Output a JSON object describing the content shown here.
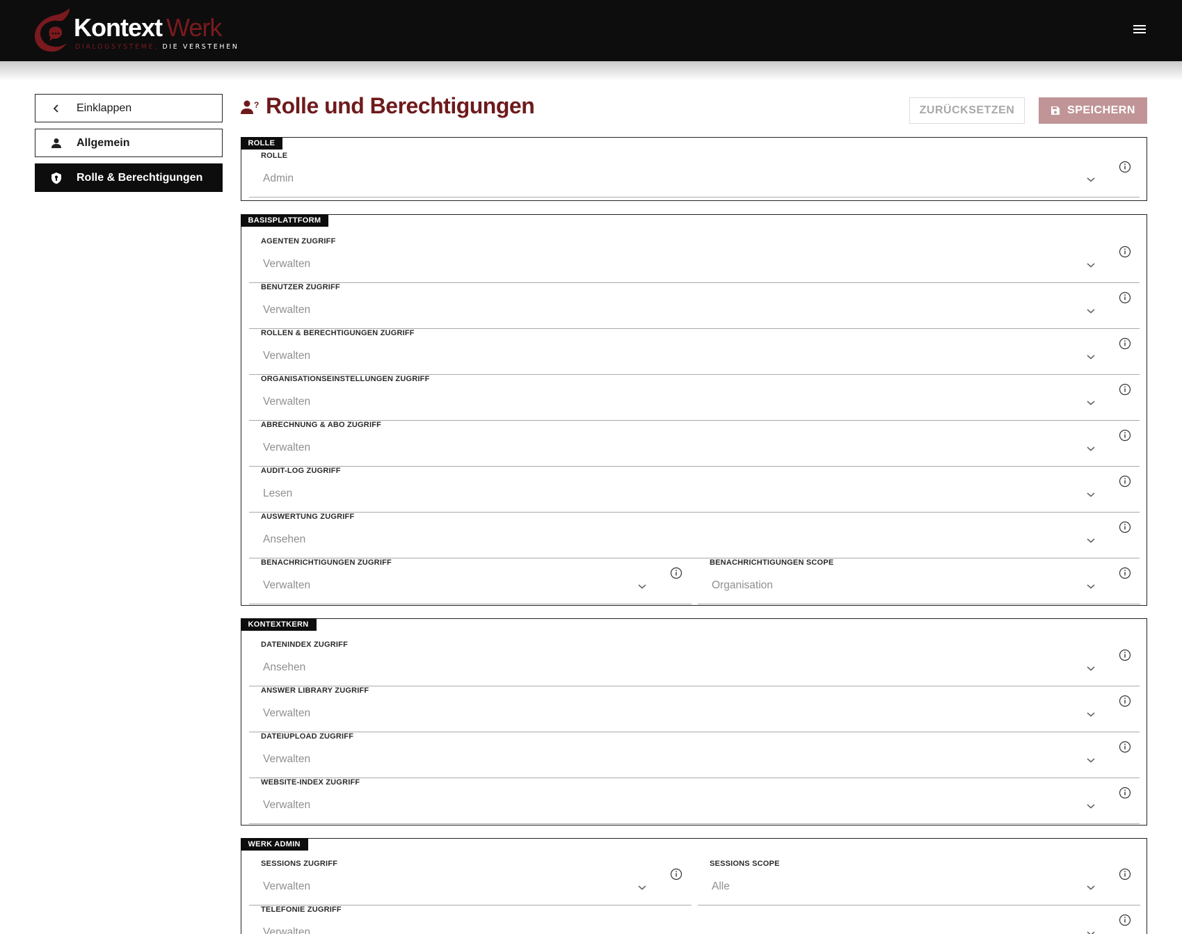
{
  "header": {
    "logo": {
      "word1": "Kontext",
      "word2": "Werk",
      "tag1": "DIALOGSYSTEME,",
      "tag2": "DIE VERSTEHEN"
    },
    "menu_icon": "hamburger-menu-icon"
  },
  "sidebar": {
    "items": [
      {
        "label": "Einklappen",
        "icon": "chevron-left-icon"
      },
      {
        "label": "Allgemein",
        "icon": "user-icon"
      },
      {
        "label": "Rolle & Berechtigungen",
        "icon": "shield-icon"
      }
    ]
  },
  "page": {
    "title": "Rolle und Berechtigungen",
    "title_icon": "user-question-icon",
    "reset_label": "ZURÜCKSETZEN",
    "save_label": "SPEICHERN",
    "save_icon": "floppy-disk-icon"
  },
  "colors": {
    "brand": "#6e1a1c",
    "save_button": "#c19597",
    "topbar": "#0d0d0d"
  },
  "sections": [
    {
      "tag": "ROLLE",
      "fields": [
        {
          "label": "ROLLE",
          "value": "Admin"
        }
      ]
    },
    {
      "tag": "BASISPLATTFORM",
      "fields": [
        {
          "label": "AGENTEN ZUGRIFF",
          "value": "Verwalten"
        },
        {
          "label": "BENUTZER ZUGRIFF",
          "value": "Verwalten"
        },
        {
          "label": "ROLLEN & BERECHTIGUNGEN ZUGRIFF",
          "value": "Verwalten"
        },
        {
          "label": "ORGANISATIONSEINSTELLUNGEN ZUGRIFF",
          "value": "Verwalten"
        },
        {
          "label": "ABRECHNUNG & ABO ZUGRIFF",
          "value": "Verwalten"
        },
        {
          "label": "AUDIT-LOG ZUGRIFF",
          "value": "Lesen"
        },
        {
          "label": "AUSWERTUNG ZUGRIFF",
          "value": "Ansehen"
        },
        {
          "label": "BENACHRICHTIGUNGEN ZUGRIFF",
          "value": "Verwalten"
        },
        {
          "label": "BENACHRICHTIGUNGEN SCOPE",
          "value": "Organisation"
        }
      ]
    },
    {
      "tag": "KONTEXTKERN",
      "fields": [
        {
          "label": "DATENINDEX ZUGRIFF",
          "value": "Ansehen"
        },
        {
          "label": "ANSWER LIBRARY ZUGRIFF",
          "value": "Verwalten"
        },
        {
          "label": "DATEIUPLOAD ZUGRIFF",
          "value": "Verwalten"
        },
        {
          "label": "WEBSITE-INDEX ZUGRIFF",
          "value": "Verwalten"
        }
      ]
    },
    {
      "tag": "WERK ADMIN",
      "fields": [
        {
          "label": "SESSIONS ZUGRIFF",
          "value": "Verwalten"
        },
        {
          "label": "SESSIONS SCOPE",
          "value": "Alle"
        },
        {
          "label": "TELEFONIE ZUGRIFF",
          "value": "Verwalten"
        }
      ]
    }
  ]
}
